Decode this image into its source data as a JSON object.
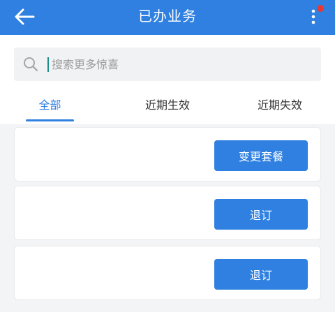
{
  "header": {
    "title": "已办业务",
    "back_icon": "arrow-left-icon",
    "more_icon": "more-vertical-icon",
    "notification_color": "#e53935",
    "background_color": "#2f80e0"
  },
  "search": {
    "placeholder": "搜索更多惊喜",
    "value": "",
    "icon": "search-icon"
  },
  "tabs": [
    {
      "label": "全部",
      "active": true
    },
    {
      "label": "近期生效",
      "active": false
    },
    {
      "label": "近期失效",
      "active": false
    }
  ],
  "cards": [
    {
      "button_label": "变更套餐"
    },
    {
      "button_label": "退订"
    },
    {
      "button_label": "退订"
    }
  ],
  "colors": {
    "accent": "#2f80e0",
    "page_background": "#f3f4f6",
    "card_border": "#e8e9eb"
  }
}
